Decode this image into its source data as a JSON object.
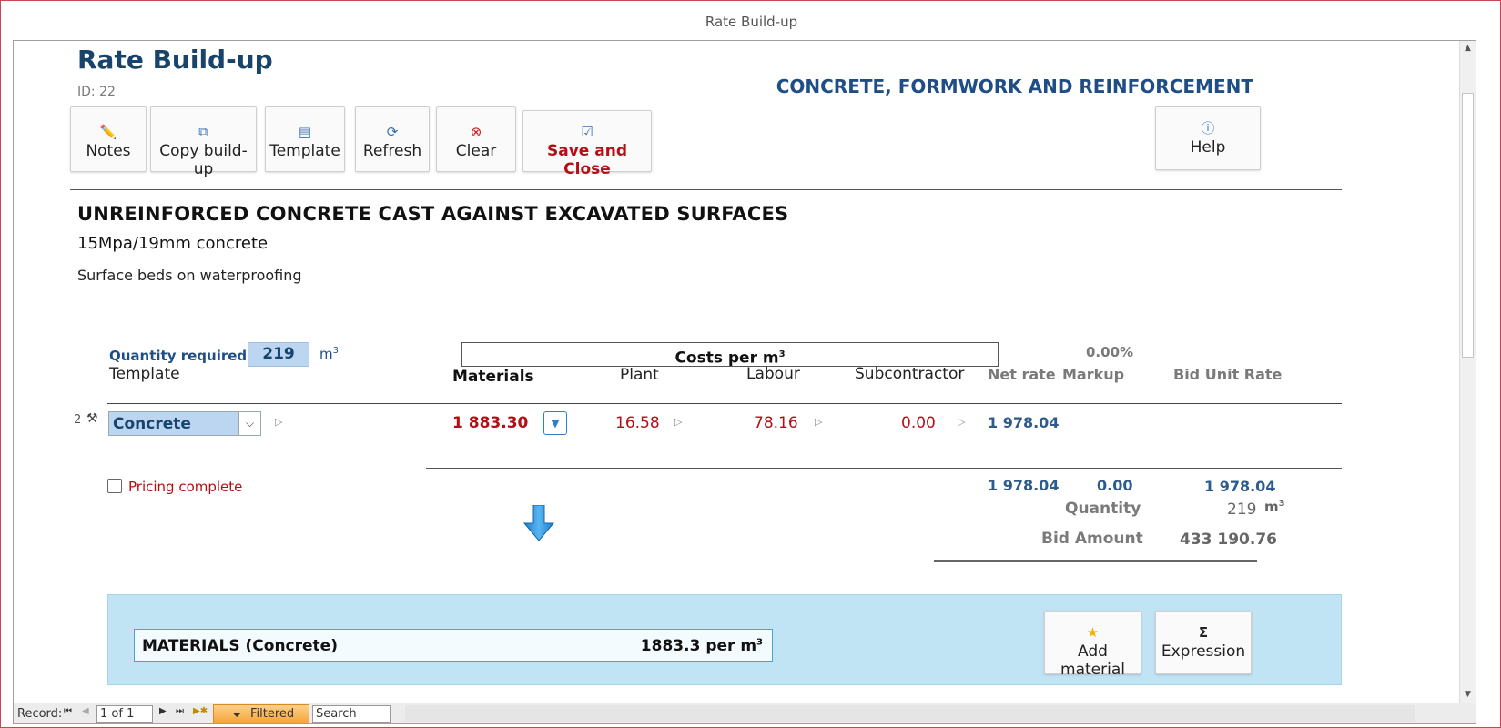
{
  "window": {
    "title": "Rate Build-up"
  },
  "header": {
    "title": "Rate Build-up",
    "id_label": "ID: 22",
    "section_name": "CONCRETE, FORMWORK AND REINFORCEMENT"
  },
  "toolbar": {
    "notes": "Notes",
    "copy_buildup": "Copy build-up",
    "template": "Template",
    "refresh": "Refresh",
    "clear": "Clear",
    "save_close_first": "S",
    "save_close_rest": "ave and Close",
    "help": "Help"
  },
  "item": {
    "heading": "UNREINFORCED CONCRETE CAST AGAINST EXCAVATED SURFACES",
    "description": "15Mpa/19mm concrete",
    "subdescription": "Surface beds on waterproofing"
  },
  "quantity": {
    "label": "Quantity required:",
    "value": "219",
    "unit": "m",
    "unit_sup": "3"
  },
  "costs_header": {
    "label": "Costs per m",
    "sup": "3"
  },
  "columns": {
    "template": "Template",
    "materials": "Materials",
    "plant": "Plant",
    "labour": "Labour",
    "subcontractor": "Subcontractor",
    "net_rate": "Net rate",
    "markup": "Markup",
    "markup_pct": "0.00%",
    "bid_unit_rate": "Bid Unit Rate"
  },
  "row": {
    "number": "2",
    "template_value": "Concrete",
    "materials": "1 883.30",
    "plant": "16.58",
    "labour": "78.16",
    "subcontractor": "0.00",
    "net_rate": "1 978.04"
  },
  "totals": {
    "net_rate": "1 978.04",
    "markup": "0.00",
    "bid_unit_rate": "1 978.04"
  },
  "pricing_complete": {
    "label": "Pricing complete",
    "checked": false
  },
  "summary": {
    "quantity_label": "Quantity",
    "quantity_value": "219",
    "quantity_unit": "m",
    "quantity_unit_sup": "3",
    "bid_amount_label": "Bid Amount",
    "bid_amount_value": "433 190.76"
  },
  "materials_panel": {
    "title": "MATERIALS  (Concrete)",
    "rate": "1883.3 per m",
    "rate_sup": "3",
    "add_material": "Add material",
    "expression": "Expression",
    "expression_icon": "Σ"
  },
  "record_nav": {
    "label": "Record:",
    "position": "1 of 1",
    "filter_label": "Filtered",
    "search_placeholder": "Search"
  },
  "colors": {
    "title_blue": "#18446b",
    "value_red": "#b50f16",
    "accent_blue": "#2d5b8e",
    "panel_blue": "#c1e4f4"
  }
}
